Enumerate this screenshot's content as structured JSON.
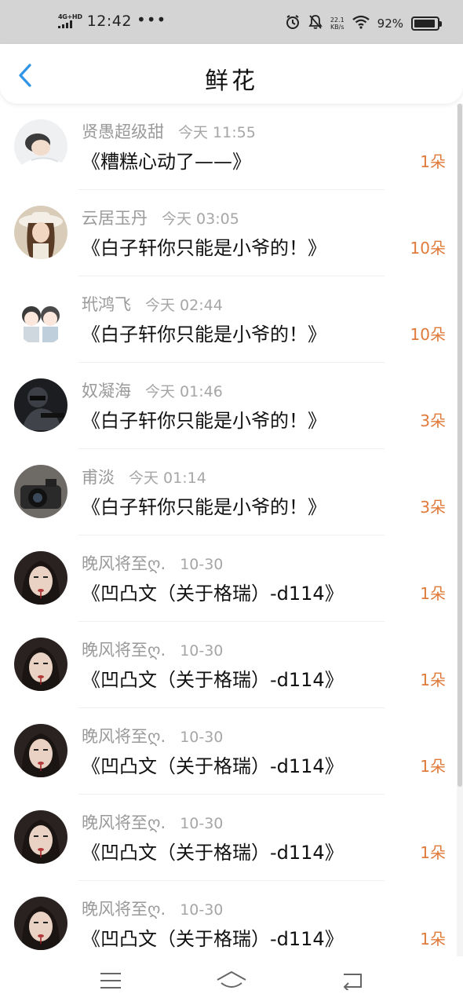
{
  "status_bar": {
    "network": "4G+HD",
    "time": "12:42",
    "dots": "•••",
    "speed_value": "22.1",
    "speed_unit": "KB/s",
    "battery_pct": "92%",
    "battery_level": 0.92
  },
  "header": {
    "title": "鲜花",
    "back_icon": "chevron-left-icon"
  },
  "colors": {
    "accent": "#2f95e8",
    "count": "#e07a3a",
    "status_bar_bg": "#d4d4d4"
  },
  "items": [
    {
      "sender": "贤愚超级甜",
      "time": "今天 11:55",
      "title": "《糟糕心动了——》",
      "count": "1朵",
      "avatar": "sleeping-person"
    },
    {
      "sender": "云居玉丹",
      "time": "今天 03:05",
      "title": "《白子轩你只能是小爷的！》",
      "count": "10朵",
      "avatar": "girl-in-hat"
    },
    {
      "sender": "玳鸿飞",
      "time": "今天 02:44",
      "title": "《白子轩你只能是小爷的！》",
      "count": "10朵",
      "avatar": "cartoon-couple"
    },
    {
      "sender": "奴凝海",
      "time": "今天 01:46",
      "title": "《白子轩你只能是小爷的！》",
      "count": "3朵",
      "avatar": "soldier"
    },
    {
      "sender": "甫淡",
      "time": "今天 01:14",
      "title": "《白子轩你只能是小爷的！》",
      "count": "3朵",
      "avatar": "camera"
    },
    {
      "sender": "晚风将至ღ.",
      "time": "10-30",
      "title": "《凹凸文（关于格瑞）-d114》",
      "count": "1朵",
      "avatar": "dark-hair-girl"
    },
    {
      "sender": "晚风将至ღ.",
      "time": "10-30",
      "title": "《凹凸文（关于格瑞）-d114》",
      "count": "1朵",
      "avatar": "dark-hair-girl"
    },
    {
      "sender": "晚风将至ღ.",
      "time": "10-30",
      "title": "《凹凸文（关于格瑞）-d114》",
      "count": "1朵",
      "avatar": "dark-hair-girl"
    },
    {
      "sender": "晚风将至ღ.",
      "time": "10-30",
      "title": "《凹凸文（关于格瑞）-d114》",
      "count": "1朵",
      "avatar": "dark-hair-girl"
    },
    {
      "sender": "晚风将至ღ.",
      "time": "10-30",
      "title": "《凹凸文（关于格瑞）-d114》",
      "count": "1朵",
      "avatar": "dark-hair-girl"
    }
  ],
  "nav": {
    "menu_icon": "menu-icon",
    "home_icon": "home-icon",
    "back_icon": "back-icon"
  }
}
